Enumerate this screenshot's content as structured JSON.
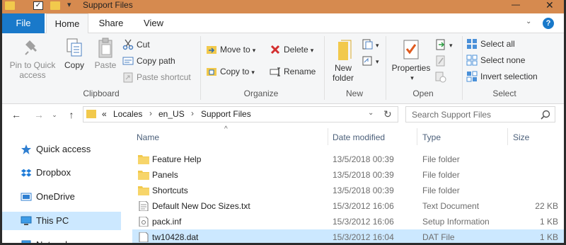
{
  "window": {
    "title": "Support Files",
    "quick_access_dropdown": "▾",
    "minimize": "—",
    "close": "✕"
  },
  "tabs": {
    "file": "File",
    "home": "Home",
    "share": "Share",
    "view": "View",
    "collapse": "⌄",
    "help": "?"
  },
  "ribbon": {
    "clipboard": {
      "group_label": "Clipboard",
      "pin_label_1": "Pin to Quick",
      "pin_label_2": "access",
      "copy": "Copy",
      "paste": "Paste",
      "cut": "Cut",
      "copy_path": "Copy path",
      "paste_shortcut": "Paste shortcut"
    },
    "organize": {
      "group_label": "Organize",
      "move_to": "Move to",
      "copy_to": "Copy to",
      "delete": "Delete",
      "rename": "Rename"
    },
    "new": {
      "group_label": "New",
      "new_folder_1": "New",
      "new_folder_2": "folder"
    },
    "open": {
      "group_label": "Open",
      "properties": "Properties"
    },
    "select": {
      "group_label": "Select",
      "select_all": "Select all",
      "select_none": "Select none",
      "invert_selection": "Invert selection"
    }
  },
  "address": {
    "overflow": "«",
    "crumbs": [
      "Locales",
      "en_US",
      "Support Files"
    ],
    "separator": "›",
    "search_placeholder": "Search Support Files"
  },
  "nav_pane": {
    "items": [
      "Quick access",
      "Dropbox",
      "OneDrive",
      "This PC",
      "Network"
    ]
  },
  "columns": {
    "name": "Name",
    "date_modified": "Date modified",
    "type": "Type",
    "size": "Size",
    "sort_indicator": "^"
  },
  "files": [
    {
      "name": "Feature Help",
      "date": "13/5/2018 00:39",
      "type": "File folder",
      "size": "",
      "kind": "folder"
    },
    {
      "name": "Panels",
      "date": "13/5/2018 00:39",
      "type": "File folder",
      "size": "",
      "kind": "folder"
    },
    {
      "name": "Shortcuts",
      "date": "13/5/2018 00:39",
      "type": "File folder",
      "size": "",
      "kind": "folder"
    },
    {
      "name": "Default New Doc Sizes.txt",
      "date": "15/3/2012 16:06",
      "type": "Text Document",
      "size": "22 KB",
      "kind": "text"
    },
    {
      "name": "pack.inf",
      "date": "15/3/2012 16:06",
      "type": "Setup Information",
      "size": "1 KB",
      "kind": "inf"
    },
    {
      "name": "tw10428.dat",
      "date": "15/3/2012 16:04",
      "type": "DAT File",
      "size": "1 KB",
      "kind": "dat"
    }
  ],
  "colors": {
    "accent": "#1979ca",
    "titlebar": "#d68a4f",
    "selection": "#cce8ff",
    "folder": "#f2c94c"
  }
}
